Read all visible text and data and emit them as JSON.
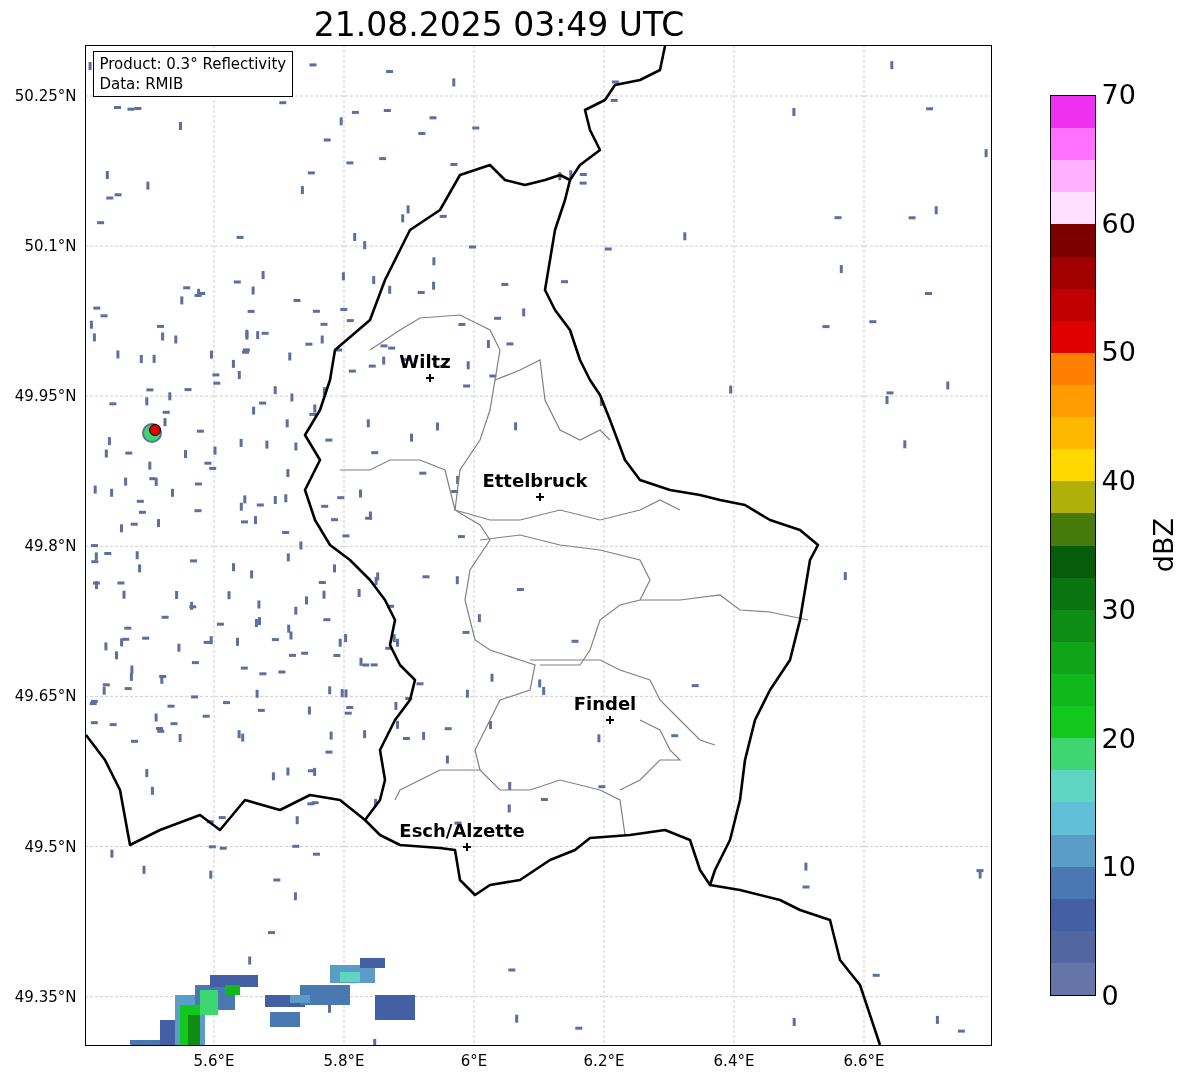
{
  "title": "21.08.2025 03:49 UTC",
  "info_box": [
    "Product: 0.3° Reflectivity",
    "Data: RMIB"
  ],
  "map": {
    "yticks": [
      "50.25°N",
      "50.1°N",
      "49.95°N",
      "49.8°N",
      "49.65°N",
      "49.5°N",
      "49.35°N"
    ],
    "xticks": [
      "5.6°E",
      "5.8°E",
      "6°E",
      "6.2°E",
      "6.4°E",
      "6.6°E"
    ],
    "cities": [
      {
        "name": "Wiltz"
      },
      {
        "name": "Ettelbruck"
      },
      {
        "name": "Findel"
      },
      {
        "name": "Esch/Alzette"
      }
    ]
  },
  "colorbar": {
    "label": "dBZ",
    "ticks": [
      "70",
      "60",
      "50",
      "40",
      "30",
      "20",
      "10",
      "0"
    ],
    "bins": [
      {
        "color": "#f030f0"
      },
      {
        "color": "#ff70ff"
      },
      {
        "color": "#ffb0ff"
      },
      {
        "color": "#ffe0ff"
      },
      {
        "color": "#7c0000"
      },
      {
        "color": "#a00000"
      },
      {
        "color": "#c00000"
      },
      {
        "color": "#e00000"
      },
      {
        "color": "#ff8000"
      },
      {
        "color": "#ff9c00"
      },
      {
        "color": "#ffb800"
      },
      {
        "color": "#ffd800"
      },
      {
        "color": "#b0b00a"
      },
      {
        "color": "#467a0a"
      },
      {
        "color": "#075c0c"
      },
      {
        "color": "#0a7410"
      },
      {
        "color": "#0e8c14"
      },
      {
        "color": "#10a418"
      },
      {
        "color": "#10b81c"
      },
      {
        "color": "#12c81c"
      },
      {
        "color": "#3ed670"
      },
      {
        "color": "#5fd6c2"
      },
      {
        "color": "#62bfd8"
      },
      {
        "color": "#5a9ec8"
      },
      {
        "color": "#4a78b2"
      },
      {
        "color": "#4360a4"
      },
      {
        "color": "#5466a0"
      },
      {
        "color": "#6575a8"
      }
    ]
  }
}
